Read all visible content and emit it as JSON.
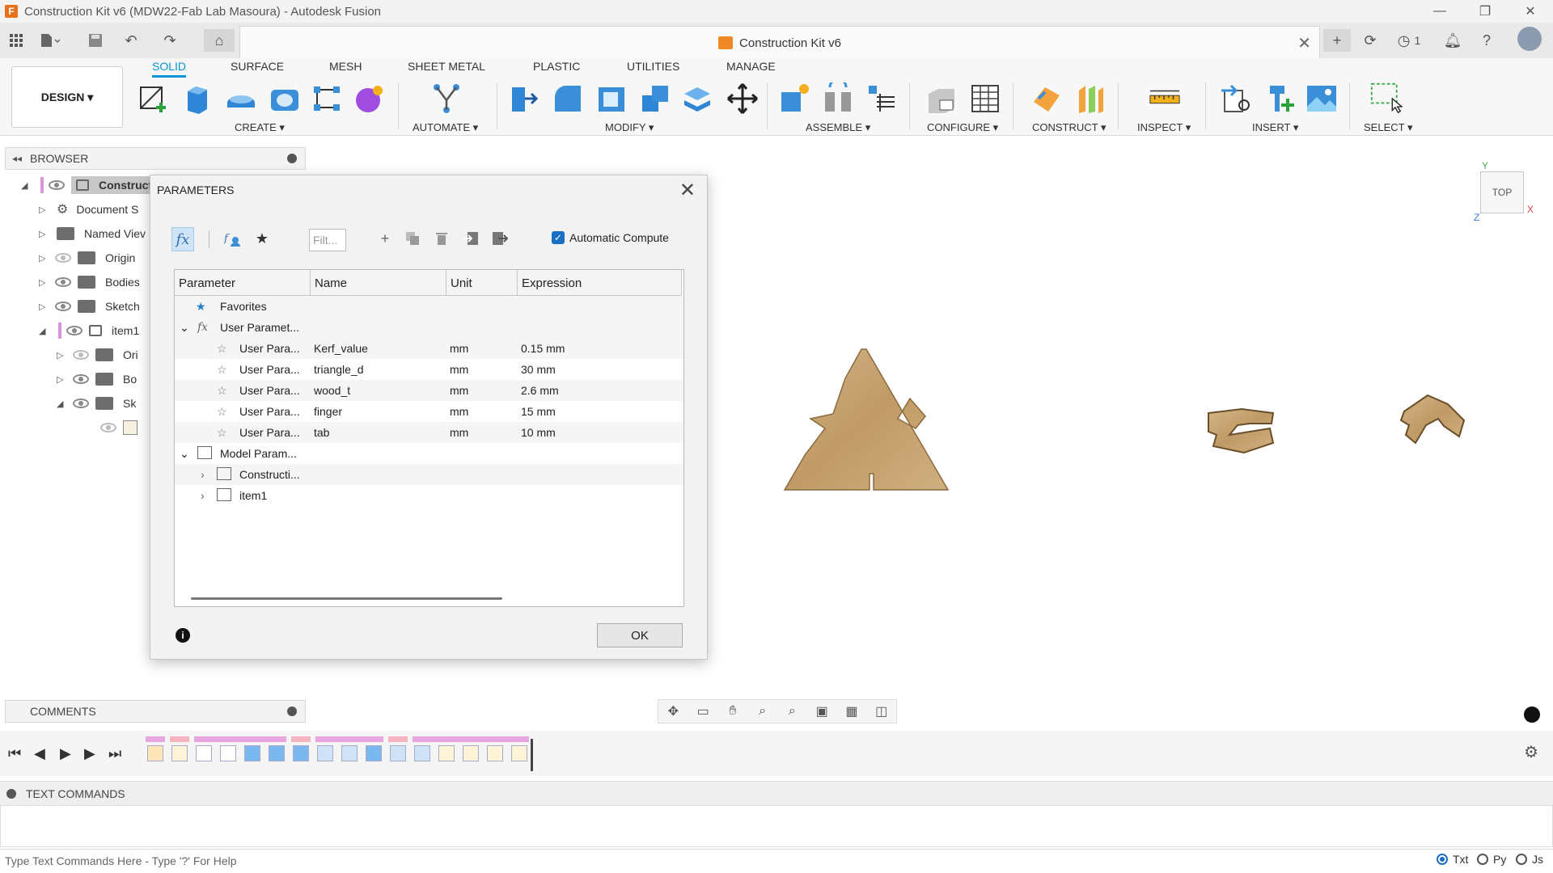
{
  "window": {
    "title": "Construction Kit v6 (MDW22-Fab Lab Masoura) - Autodesk Fusion",
    "controls": [
      "—",
      "❐",
      "✕"
    ]
  },
  "doc_tab": {
    "title": "Construction Kit v6",
    "close": "✕"
  },
  "quick_access": {
    "job_count": "1"
  },
  "ribbon": {
    "workspace": "DESIGN ▾",
    "tabs": [
      "SOLID",
      "SURFACE",
      "MESH",
      "SHEET METAL",
      "PLASTIC",
      "UTILITIES",
      "MANAGE"
    ],
    "groups": [
      "CREATE ▾",
      "AUTOMATE ▾",
      "MODIFY ▾",
      "ASSEMBLE ▾",
      "CONFIGURE ▾",
      "CONSTRUCT ▾",
      "INSPECT ▾",
      "INSERT ▾",
      "SELECT ▾"
    ]
  },
  "browser": {
    "title": "BROWSER",
    "items": [
      "Constructi",
      "Document S",
      "Named Viev",
      "Origin",
      "Bodies",
      "Sketch",
      "item1",
      "Ori",
      "Bo",
      "Sk"
    ]
  },
  "viewcube": {
    "face": "TOP",
    "x": "X",
    "y": "Y",
    "z": "Z"
  },
  "dialog": {
    "title": "PARAMETERS",
    "fx_label": "fx",
    "filter_placeholder": "Filt...",
    "auto_compute": "Automatic Compute",
    "columns": [
      "Parameter",
      "Name",
      "Unit",
      "Expression"
    ],
    "favorites": "Favorites",
    "user_group": "User Paramet...",
    "user_params": [
      {
        "param": "User Para...",
        "name": "Kerf_value",
        "unit": "mm",
        "expr": "0.15 mm"
      },
      {
        "param": "User Para...",
        "name": "triangle_d",
        "unit": "mm",
        "expr": "30 mm"
      },
      {
        "param": "User Para...",
        "name": "wood_t",
        "unit": "mm",
        "expr": "2.6 mm"
      },
      {
        "param": "User Para...",
        "name": "finger",
        "unit": "mm",
        "expr": "15 mm"
      },
      {
        "param": "User Para...",
        "name": "tab",
        "unit": "mm",
        "expr": "10 mm"
      }
    ],
    "model_group": "Model Param...",
    "model_items": [
      "Constructi...",
      "item1"
    ],
    "ok": "OK",
    "info": "i"
  },
  "comments": {
    "title": "COMMENTS"
  },
  "text_commands": {
    "title": "TEXT COMMANDS",
    "placeholder": "Type Text Commands Here - Type '?' For Help",
    "modes": [
      "Txt",
      "Py",
      "Js"
    ]
  },
  "colors": {
    "accent": "#0696d7",
    "wood": "#c8a877"
  }
}
